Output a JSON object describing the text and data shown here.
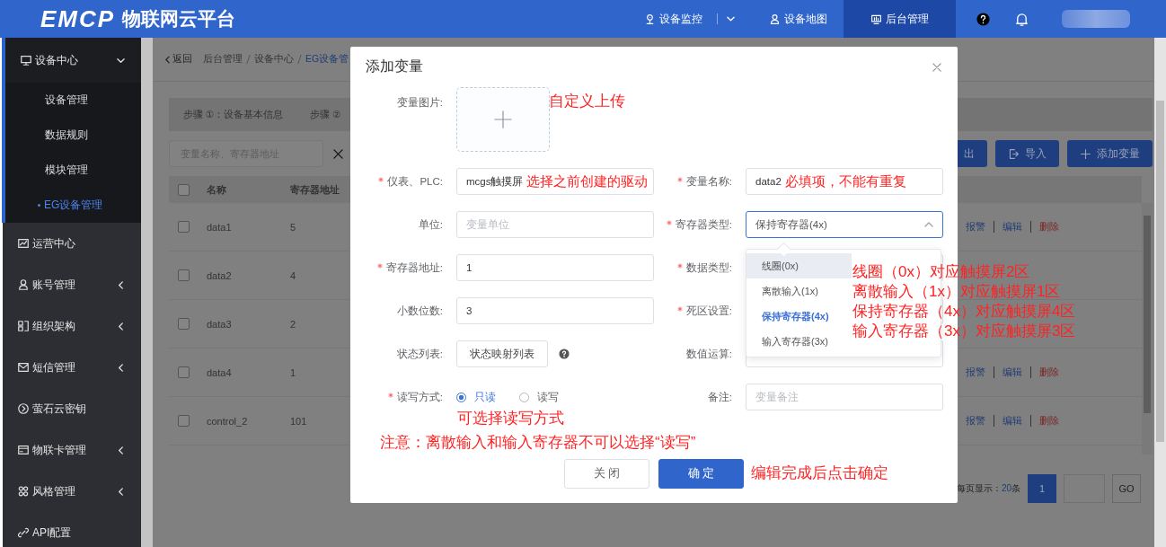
{
  "header": {
    "logo": "EMCP",
    "platform": "物联网云平台",
    "nav": [
      {
        "label": "设备监控",
        "selected": false,
        "dropdown": true
      },
      {
        "label": "设备地图",
        "selected": false,
        "dropdown": false
      },
      {
        "label": "后台管理",
        "selected": true,
        "dropdown": false
      }
    ]
  },
  "sidebar": {
    "items": [
      {
        "label": "设备中心",
        "expanded": true,
        "children": [
          {
            "label": "设备管理",
            "selected": false
          },
          {
            "label": "数据规则",
            "selected": false
          },
          {
            "label": "模块管理",
            "selected": false
          },
          {
            "label": "EG设备管理",
            "selected": true
          }
        ]
      },
      {
        "label": "运营中心"
      },
      {
        "label": "账号管理",
        "expanded": false
      },
      {
        "label": "组织架构",
        "expanded": false
      },
      {
        "label": "短信管理",
        "expanded": false
      },
      {
        "label": "萤石云密钥"
      },
      {
        "label": "物联卡管理",
        "expanded": false
      },
      {
        "label": "风格管理",
        "expanded": false
      },
      {
        "label": "API配置"
      }
    ]
  },
  "breadcrumb": {
    "back": "返回",
    "items": [
      "后台管理",
      "设备中心",
      "EG设备管"
    ]
  },
  "steps": [
    "步骤 ①：设备基本信息",
    "步骤 ②"
  ],
  "search": {
    "placeholder": "变量名称、寄存器地址"
  },
  "toolbar": [
    "出",
    "导入",
    "添加变量"
  ],
  "table": {
    "all_checked": false,
    "columns": [
      "名称",
      "寄存器地址"
    ],
    "rows": [
      {
        "checked": false,
        "name": "data1",
        "address": "5",
        "actions": [
          {
            "label": "报警",
            "kind": "normal"
          },
          {
            "label": "编辑",
            "kind": "normal"
          },
          {
            "label": "删除",
            "kind": "danger"
          }
        ]
      },
      {
        "checked": false,
        "name": "data2",
        "address": "4"
      },
      {
        "checked": false,
        "name": "data3",
        "address": "2"
      },
      {
        "checked": false,
        "name": "data4",
        "address": "1",
        "actions": [
          {
            "label": "报警",
            "kind": "normal"
          },
          {
            "label": "编辑",
            "kind": "normal"
          },
          {
            "label": "删除",
            "kind": "danger"
          }
        ]
      },
      {
        "checked": false,
        "name": "control_2",
        "address": "101",
        "actions": [
          {
            "label": "报警",
            "kind": "normal"
          },
          {
            "label": "编辑",
            "kind": "normal"
          },
          {
            "label": "删除",
            "kind": "danger"
          }
        ]
      }
    ]
  },
  "pagination": {
    "prefix": "每页显示：",
    "size": "20",
    "suffix": "条",
    "pages": [
      {
        "label": "1",
        "selected": true
      }
    ],
    "go": "GO"
  },
  "dialog": {
    "title": "添加变量",
    "rows": [
      [
        {
          "label": "变量图片:",
          "required": false,
          "kind": "upload"
        }
      ],
      [
        {
          "label": "仪表、PLC:",
          "required": true,
          "kind": "text",
          "value": "mcgs触摸屏",
          "annotation": "选择之前创建的驱动"
        },
        {
          "label": "变量名称:",
          "required": true,
          "kind": "text",
          "value": "data2",
          "annotation": "必填项，不能有重复"
        }
      ],
      [
        {
          "label": "单位:",
          "required": false,
          "kind": "text",
          "placeholder": "变量单位"
        },
        {
          "label": "寄存器类型:",
          "required": true,
          "kind": "select",
          "value": "保持寄存器(4x)",
          "expanded": true
        }
      ],
      [
        {
          "label": "寄存器地址:",
          "required": true,
          "kind": "text",
          "value": "1"
        },
        {
          "label": "数据类型:",
          "required": true,
          "kind": "text"
        }
      ],
      [
        {
          "label": "小数位数:",
          "required": false,
          "kind": "text",
          "value": "3"
        },
        {
          "label": "死区设置:",
          "required": true,
          "kind": "text"
        }
      ],
      [
        {
          "label": "状态列表:",
          "required": false,
          "kind": "button",
          "value": "状态映射列表"
        },
        {
          "label": "数值运算:",
          "required": false,
          "kind": "text"
        }
      ],
      [
        {
          "label": "读写方式:",
          "required": true,
          "kind": "radio",
          "options": [
            {
              "label": "只读",
              "selected": true
            },
            {
              "label": "读写",
              "selected": false
            }
          ]
        },
        {
          "label": "备注:",
          "required": false,
          "kind": "text",
          "placeholder": "变量备注"
        }
      ]
    ],
    "dropdown": [
      {
        "label": "线圈(0x)",
        "selected": false,
        "hovered": true
      },
      {
        "label": "离散输入(1x)",
        "selected": false,
        "hovered": false
      },
      {
        "label": "保持寄存器(4x)",
        "selected": true,
        "hovered": false
      },
      {
        "label": "输入寄存器(3x)",
        "selected": false,
        "hovered": false
      }
    ],
    "buttons": [
      {
        "label": "关 闭",
        "kind": "default"
      },
      {
        "label": "确 定",
        "kind": "primary"
      }
    ]
  },
  "annotations": [
    {
      "kind": "upload",
      "lines": [
        "自定义上传"
      ]
    },
    {
      "kind": "register",
      "lines": [
        "线圈（0x）对应触摸屏2区",
        "离散输入（1x）对应触摸屏1区",
        "保持寄存器（4x）对应触摸屏4区",
        "输入寄存器（3x）对应触摸屏3区"
      ]
    },
    {
      "kind": "mode",
      "lines": [
        "可选择读写方式"
      ]
    },
    {
      "kind": "note",
      "lines": [
        "注意：离散输入和输入寄存器不可以选择“读写”"
      ]
    },
    {
      "kind": "confirm",
      "lines": [
        "编辑完成后点击确定"
      ]
    }
  ]
}
